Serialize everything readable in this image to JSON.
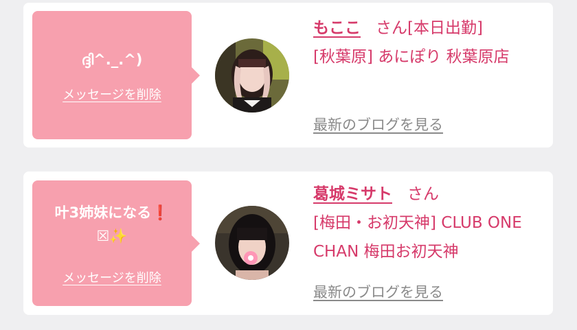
{
  "messages": [
    {
      "bubble": {
        "text": "ദ്ദി^._.^)",
        "delete_label": "メッセージを削除"
      },
      "cast": {
        "name": "もここ",
        "suffix": "さん",
        "status": "[本日出勤]",
        "shop": "[秋葉原] あにぽり 秋葉原店"
      },
      "blog_label": "最新のブログを見る"
    },
    {
      "bubble": {
        "text_line1": "叶3姉妹になる",
        "excl": "❗",
        "text_line2_box": "☒",
        "text_line2_sparkle": "✨",
        "delete_label": "メッセージを削除"
      },
      "cast": {
        "name": "葛城ミサト",
        "suffix": "さん",
        "status": "",
        "shop": "[梅田・お初天神] CLUB ONE CHAN 梅田お初天神"
      },
      "blog_label": "最新のブログを見る"
    }
  ],
  "colors": {
    "bubble": "#f7a0ae",
    "accent": "#d63a6a",
    "muted_link": "#8a8a8a",
    "background": "#efeff1"
  }
}
